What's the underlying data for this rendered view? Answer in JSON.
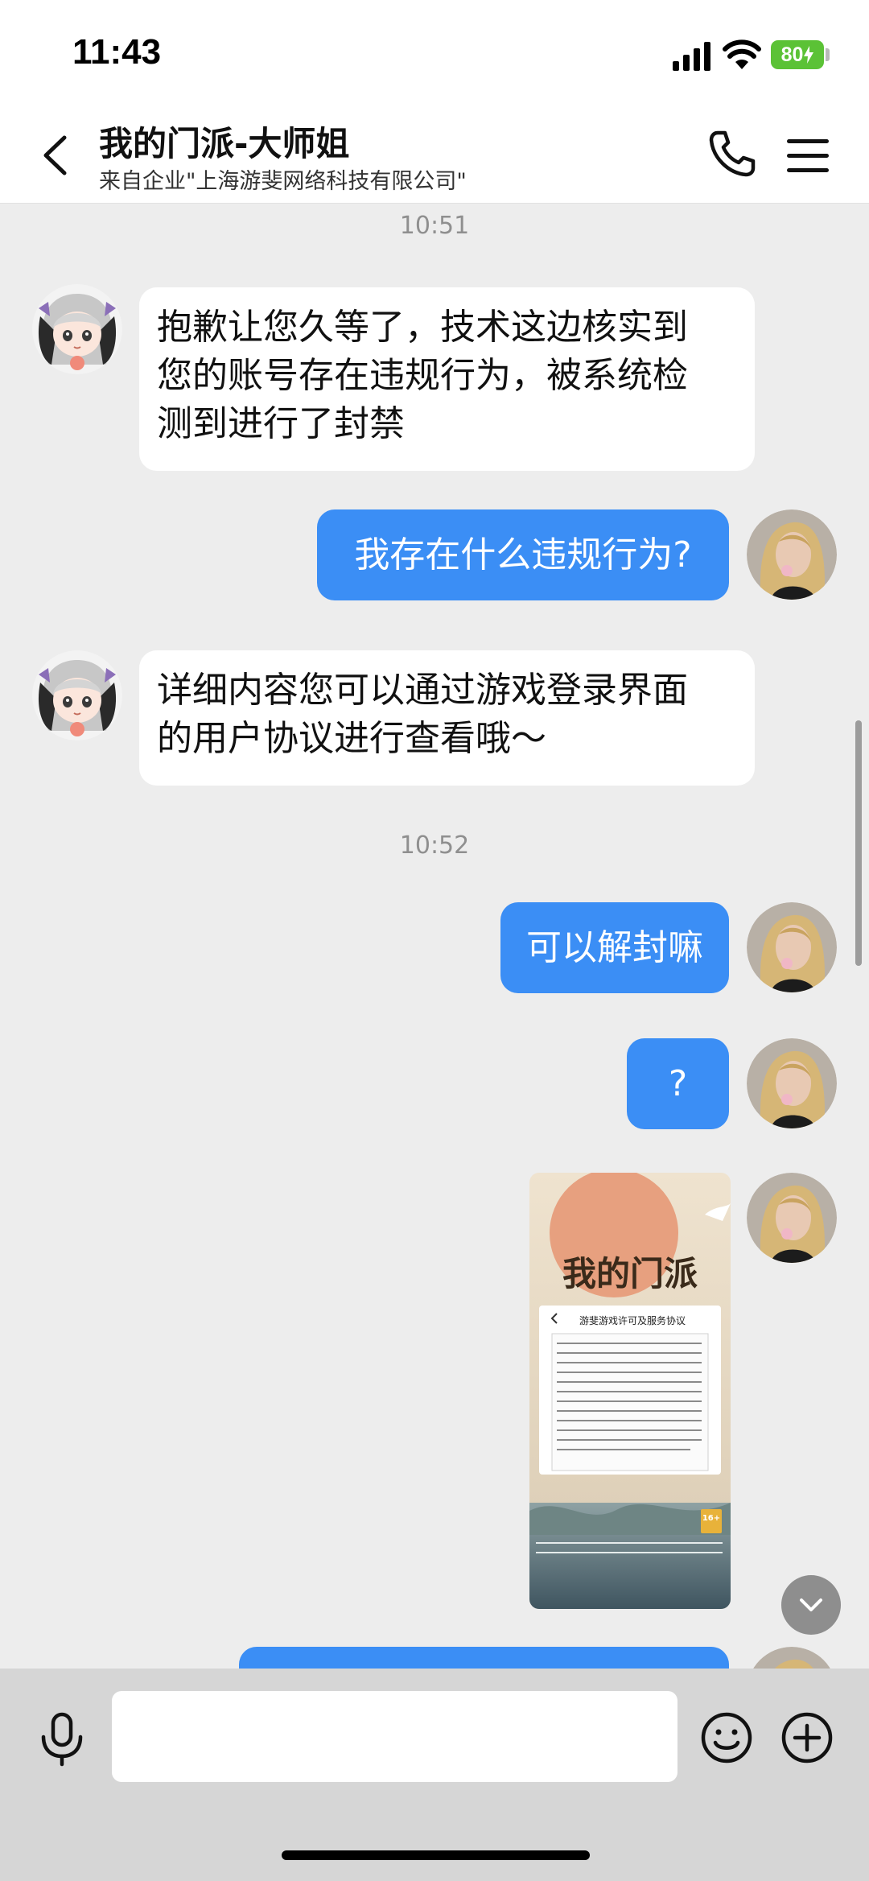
{
  "status_bar": {
    "time": "11:43",
    "battery": "80",
    "icons": [
      "signal-icon",
      "wifi-icon",
      "battery-icon",
      "charging-bolt-icon"
    ]
  },
  "header": {
    "title": "我的门派-大师姐",
    "subtitle": "来自企业\"上海游斐网络科技有限公司\"",
    "icons": [
      "back-arrow-icon",
      "phone-icon",
      "menu-icon"
    ]
  },
  "messages": {
    "time_1": "10:51",
    "m1_line1": "抱歉让您久等了，技术这边核实到",
    "m1_line2": "您的账号存在违规行为，被系统检",
    "m1_line3": "测到进行了封禁",
    "m2": "我存在什么违规行为?",
    "m3_line1": "详细内容您可以通过游戏登录界面",
    "m3_line2": "的用户协议进行查看哦～",
    "time_2": "10:52",
    "m4": "可以解封嘛",
    "m5": "?",
    "image": {
      "game_logo": "我的门派",
      "dialog_title": "游斐游戏许可及服务协议",
      "age_badge": "16+"
    }
  },
  "input_bar": {
    "placeholder": "",
    "icons": [
      "microphone-icon",
      "emoji-icon",
      "plus-icon"
    ]
  },
  "colors": {
    "outgoing_bubble": "#3b8ef5",
    "incoming_bubble": "#ffffff",
    "background": "#ededed",
    "battery": "#5bc236"
  }
}
